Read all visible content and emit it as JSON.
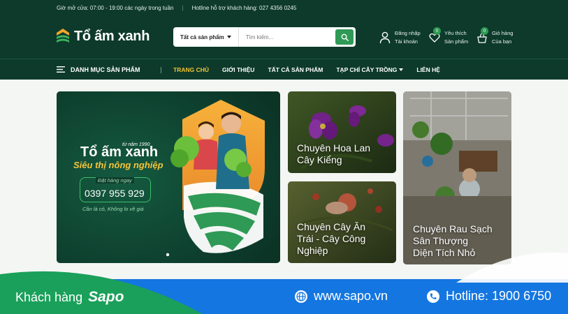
{
  "topbar": {
    "hours": "Giờ mở cửa: 07:00 - 19:00 các ngày trong tuần",
    "separator": "|",
    "hotline": "Hotline hỗ trợ khách hàng: 027 4356 0245"
  },
  "header": {
    "logo_text": "Tổ ấm xanh",
    "search": {
      "category": "Tất cả sản phẩm",
      "placeholder": "Tìm kiếm..."
    },
    "account": {
      "line1": "Đăng nhập",
      "line2": "Tài khoản"
    },
    "wishlist": {
      "count": "0",
      "line1": "Yêu thích",
      "line2": "Sản phẩm"
    },
    "cart": {
      "count": "0",
      "line1": "Giỏ hàng",
      "line2": "Của bạn"
    }
  },
  "nav": {
    "menu_label": "DANH MỤC SẢN PHẨM",
    "links": [
      "TRANG CHỦ",
      "GIỚI THIỆU",
      "TẤT CẢ SẢN PHẨM",
      "TẠP CHÍ CÂY TRỒNG",
      "LIÊN HỆ"
    ]
  },
  "banner": {
    "since": "từ năm 1990",
    "brand": "Tổ ấm xanh",
    "slogan": "Siêu thị nông nghiệp",
    "order_label": "Đặt hàng ngay",
    "phone": "0397 955 929",
    "tagline": "Cần là có, Không lo về giá"
  },
  "cards": {
    "orchid": {
      "line1": "Chuyên Hoa Lan",
      "line2": "Cây Kiểng"
    },
    "fruit": {
      "line1": "Chuyên Cây Ăn",
      "line2": "Trái - Cây Công",
      "line3": "Nghiệp"
    },
    "rooftop": {
      "line1": "Chuyên Rau Sạch",
      "line2": "Sân Thượng",
      "line3": "Diện Tích Nhỏ"
    }
  },
  "footer_strip": {
    "customer_label": "Khách hàng",
    "brand": "Sapo",
    "website": "www.sapo.vn",
    "hotline": "Hotline: 1900 6750"
  },
  "colors": {
    "header_bg": "#0d3a2b",
    "accent_green": "#2e9a55",
    "active_nav": "#f4c430",
    "strip_blue": "#1476e0",
    "strip_green": "#1aa05a"
  }
}
